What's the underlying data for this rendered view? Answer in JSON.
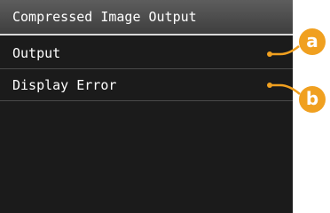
{
  "screen": {
    "title": "Compressed Image Output",
    "items": [
      {
        "label": "Output"
      },
      {
        "label": "Display Error"
      }
    ]
  },
  "callouts": [
    {
      "label": "a",
      "color": "#f0a020"
    },
    {
      "label": "b",
      "color": "#f0a020"
    }
  ]
}
